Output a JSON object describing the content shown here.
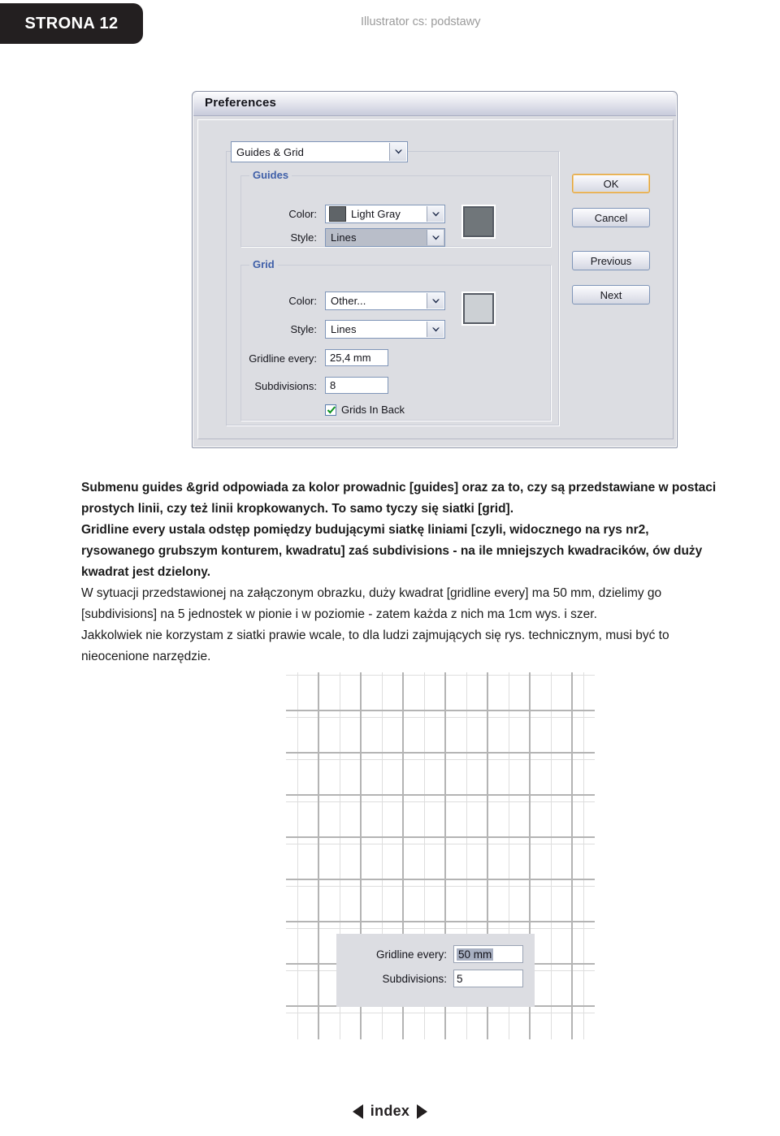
{
  "header": {
    "page_tag": "STRONA 12",
    "subtitle": "Illustrator cs: podstawy"
  },
  "dialog": {
    "title": "Preferences",
    "section_combo": {
      "value": "Guides & Grid",
      "icon": "chevron-down-icon"
    },
    "guides_group": {
      "legend": "Guides",
      "color_label": "Color:",
      "color_value": "Light Gray",
      "color_swatch_hex": "#5f6468",
      "style_label": "Style:",
      "style_value": "Lines",
      "preview_hex": "#70767a"
    },
    "grid_group": {
      "legend": "Grid",
      "color_label": "Color:",
      "color_value": "Other...",
      "style_label": "Style:",
      "style_value": "Lines",
      "preview_hex": "#ccd0d4",
      "gridline_label": "Gridline every:",
      "gridline_value": "25,4 mm",
      "subdivisions_label": "Subdivisions:",
      "subdivisions_value": "8",
      "grids_in_back_label": "Grids In Back",
      "grids_in_back_checked": true
    },
    "buttons": [
      {
        "label": "OK",
        "default": true
      },
      {
        "label": "Cancel",
        "default": false
      },
      {
        "label": "Previous",
        "default": false
      },
      {
        "label": "Next",
        "default": false
      }
    ]
  },
  "body": {
    "p1": "Submenu guides &grid odpowiada za kolor prowadnic [guides] oraz za to, czy są przedstawiane w postaci prostych linii, czy też linii kropkowanych. To samo tyczy się siatki [grid].",
    "p2": "Gridline every ustala odstęp pomiędzy budującymi siatkę liniami [czyli, widocznego na rys nr2, rysowanego grubszym konturem, kwadratu] zaś subdivisions - na ile mniejszych kwadracików, ów duży kwadrat jest dzielony.",
    "p3": "W sytuacji przedstawionej  na załączonym obrazku, duży kwadrat [gridline every] ma 50 mm, dzielimy go [subdivisions] na 5 jednostek w pionie i w poziomie - zatem każda z nich ma 1cm wys. i szer.",
    "p4": "Jakkolwiek nie korzystam z siatki prawie wcale, to dla ludzi zajmujących się rys. technicznym, musi być to nieocenione narzędzie."
  },
  "figure": {
    "gridline_label": "Gridline every:",
    "gridline_value": "50 mm",
    "subdivisions_label": "Subdivisions:",
    "subdivisions_value": "5",
    "major_color_hex": "#b4b4b4",
    "minor_color_hex": "#dcdcdc"
  },
  "footer": {
    "prev_icon": "triangle-left-icon",
    "label": "index",
    "next_icon": "triangle-right-icon"
  }
}
